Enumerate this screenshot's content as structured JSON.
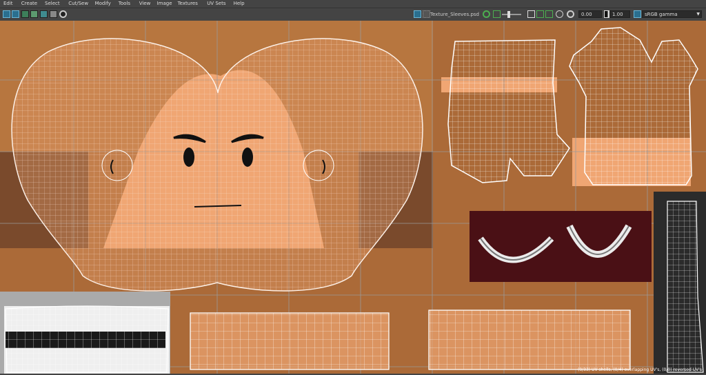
{
  "menu": [
    "Edit",
    "Create",
    "Select",
    "Cut/Sew",
    "Modify",
    "Tools",
    "View",
    "Image",
    "Textures",
    "UV Sets",
    "Help"
  ],
  "toolbar": {
    "texture_name": "Texture_Sleeves.psd",
    "value_a": "0.00",
    "value_b": "1.00",
    "color_space": "sRGB gamma",
    "icons": [
      "uv-snapshot-icon",
      "grid-toggle-icon",
      "shaded-uv-icon",
      "texture-border-icon",
      "checker-icon",
      "dim-image-icon",
      "image-display-icon",
      "texture-dropdown-icon",
      "isolate-icon",
      "exposure-slider",
      "color-picker-icon",
      "filter-icon",
      "channel-icon",
      "exposure-icon",
      "gamma-icon",
      "color-management-icon"
    ]
  },
  "status": {
    "highlight_prefix": "(0/33) UV shells, (0/4) overlapping UV's, (0/0) reversed UV's"
  },
  "colors": {
    "skin": "#f0a673",
    "background_brown": "#b06f3c",
    "wireframe": "#ffffff",
    "teeth_backdrop": "#4a1015",
    "panel_dark": "#444444"
  }
}
